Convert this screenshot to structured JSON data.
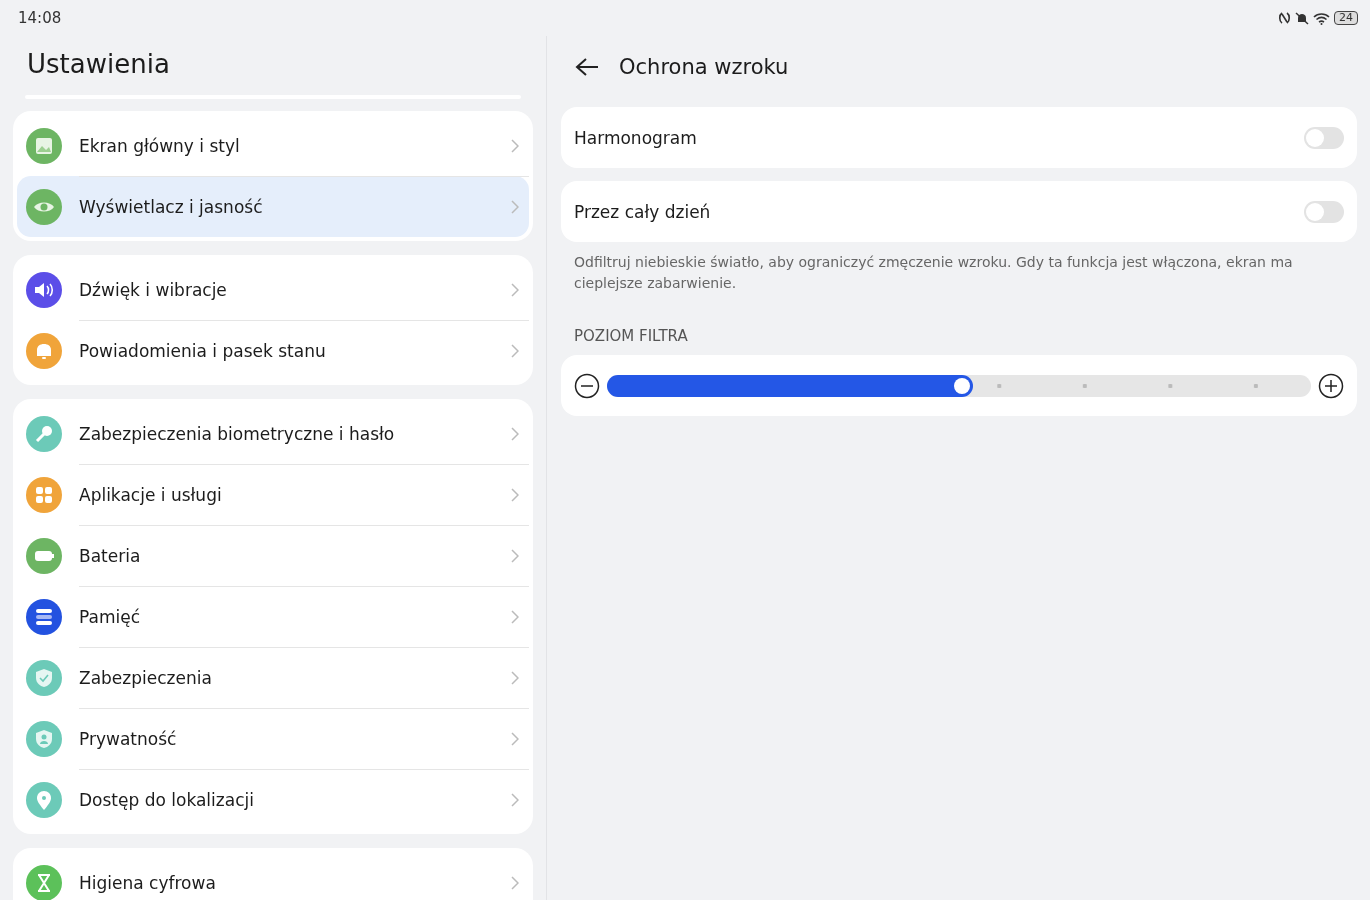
{
  "status_bar": {
    "time": "14:08",
    "battery": "24"
  },
  "sidebar": {
    "title": "Ustawienia",
    "groups": [
      {
        "items": [
          {
            "label": "Ekran główny i styl",
            "kind": "picture",
            "color": "#6db563",
            "selected": false
          },
          {
            "label": "Wyświetlacz i jasność",
            "kind": "eye",
            "color": "#6db563",
            "selected": true
          }
        ]
      },
      {
        "items": [
          {
            "label": "Dźwięk i wibracje",
            "kind": "speaker",
            "color": "#5b4ee8",
            "selected": false
          },
          {
            "label": "Powiadomienia i pasek stanu",
            "kind": "bell",
            "color": "#f0a43a",
            "selected": false
          }
        ]
      },
      {
        "items": [
          {
            "label": "Zabezpieczenia biometryczne i hasło",
            "kind": "key",
            "color": "#6ccab8",
            "selected": false
          },
          {
            "label": "Aplikacje i usługi",
            "kind": "grid",
            "color": "#f0a43a",
            "selected": false
          },
          {
            "label": "Bateria",
            "kind": "battery",
            "color": "#6db563",
            "selected": false
          },
          {
            "label": "Pamięć",
            "kind": "storage",
            "color": "#2352e0",
            "selected": false
          },
          {
            "label": "Zabezpieczenia",
            "kind": "shield",
            "color": "#6ccab8",
            "selected": false
          },
          {
            "label": "Prywatność",
            "kind": "privacy",
            "color": "#6ccab8",
            "selected": false
          },
          {
            "label": "Dostęp do lokalizacji",
            "kind": "pin",
            "color": "#6ccab8",
            "selected": false
          }
        ]
      },
      {
        "items": [
          {
            "label": "Higiena cyfrowa",
            "kind": "hourglass",
            "color": "#5cc15a",
            "selected": false
          }
        ]
      }
    ]
  },
  "detail": {
    "title": "Ochrona wzroku",
    "toggles": [
      {
        "label": "Harmonogram",
        "on": false
      },
      {
        "label": "Przez cały dzień",
        "on": false
      }
    ],
    "description": "Odfiltruj niebieskie światło, aby ograniczyć zmęczenie wzroku. Gdy ta funkcja jest włączona, ekran ma cieplejsze zabarwienie.",
    "filter_section": "POZIOM FILTRA",
    "filter_slider": {
      "level": 0.52
    }
  }
}
